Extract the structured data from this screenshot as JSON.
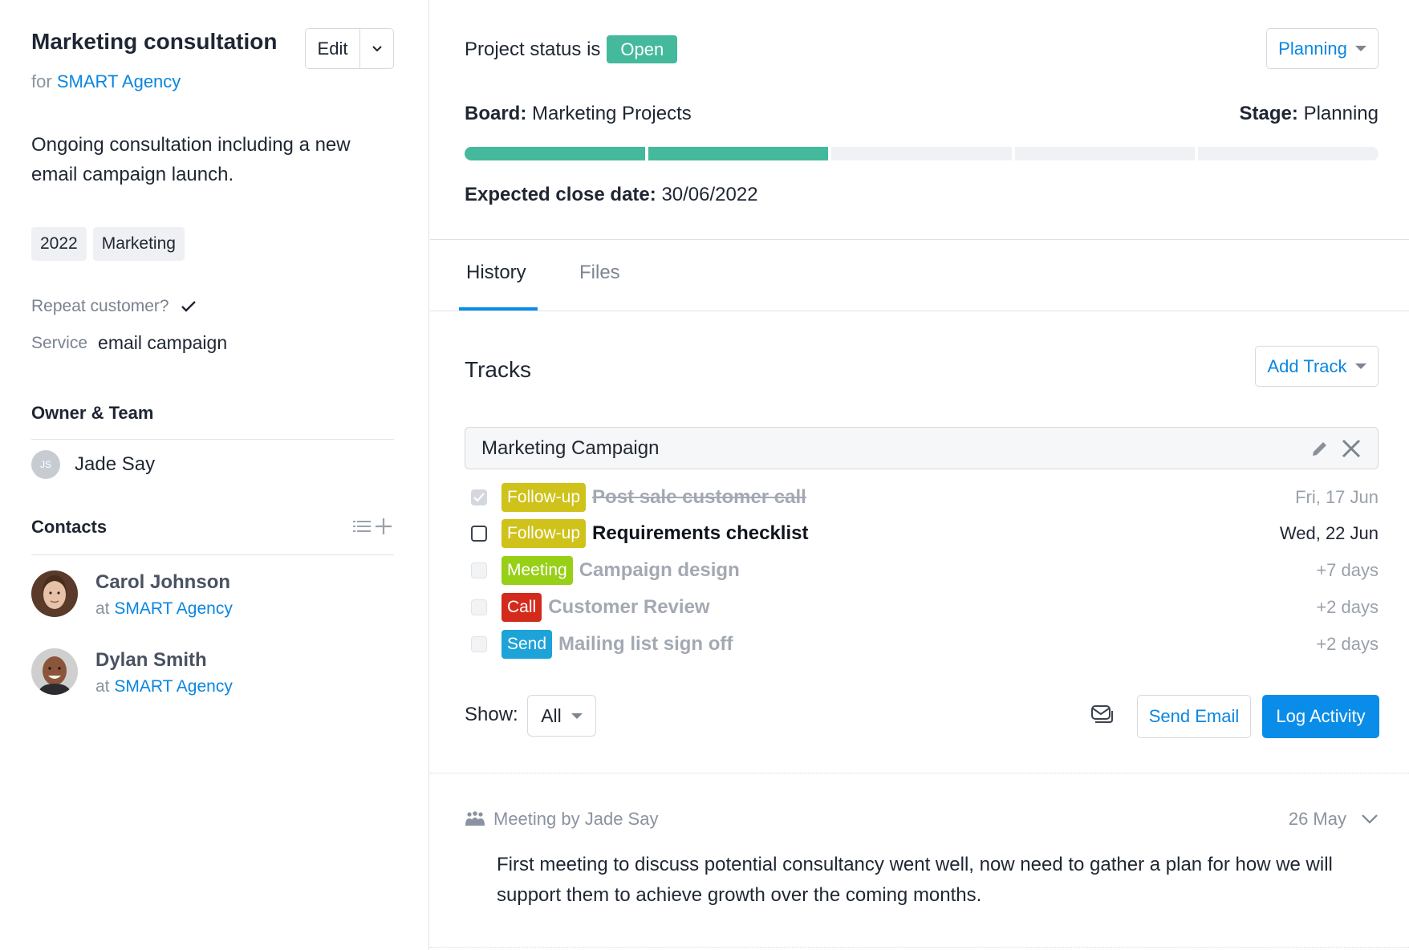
{
  "project": {
    "title": "Marketing consultation",
    "for_prefix": "for",
    "company": "SMART Agency",
    "edit_label": "Edit",
    "description": "Ongoing consultation including a new email campaign launch.",
    "tags": [
      "2022",
      "Marketing"
    ],
    "fields": {
      "repeat_customer_label": "Repeat customer?",
      "repeat_customer_value": true,
      "service_label": "Service",
      "service_value": "email campaign"
    },
    "owner_section_title": "Owner & Team",
    "owner": {
      "initials": "JS",
      "name": "Jade Say"
    },
    "contacts_section_title": "Contacts",
    "contacts": [
      {
        "name": "Carol Johnson",
        "at_prefix": "at",
        "company": "SMART Agency"
      },
      {
        "name": "Dylan Smith",
        "at_prefix": "at",
        "company": "SMART Agency"
      }
    ]
  },
  "status": {
    "label": "Project status is",
    "badge": "Open",
    "badge_color": "#45b99b",
    "stage_dropdown": "Planning",
    "board_label": "Board:",
    "board_value": "Marketing Projects",
    "stage_label": "Stage:",
    "stage_value": "Planning",
    "progress": {
      "completed_stages": 2,
      "total_stages": 5
    },
    "close_label": "Expected close date:",
    "close_value": "30/06/2022"
  },
  "tabs": [
    {
      "label": "History",
      "active": true
    },
    {
      "label": "Files",
      "active": false
    }
  ],
  "tracks": {
    "title": "Tracks",
    "add_button": "Add Track",
    "track_name": "Marketing Campaign",
    "tasks": [
      {
        "type": "Follow-up",
        "type_color": "#cfc21a",
        "title": "Post sale customer call",
        "date": "Fri, 17 Jun",
        "state": "done"
      },
      {
        "type": "Follow-up",
        "type_color": "#cfc21a",
        "title": "Requirements checklist",
        "date": "Wed, 22 Jun",
        "state": "current"
      },
      {
        "type": "Meeting",
        "type_color": "#98cf17",
        "title": "Campaign design",
        "date": "+7 days",
        "state": "future"
      },
      {
        "type": "Call",
        "type_color": "#d42a1c",
        "title": "Customer Review",
        "date": "+2 days",
        "state": "future"
      },
      {
        "type": "Send",
        "type_color": "#1ea3d8",
        "title": "Mailing list sign off",
        "date": "+2 days",
        "state": "future"
      }
    ],
    "show_label": "Show:",
    "show_value": "All",
    "send_email": "Send Email",
    "log_activity": "Log Activity"
  },
  "activity": {
    "heading": "Meeting by Jade Say",
    "date": "26 May",
    "body": "First meeting to discuss potential consultancy went well, now need to gather a plan for how we will support them to achieve growth over the coming months."
  },
  "colors": {
    "accent": "#0a8de8",
    "link": "#0a86e0",
    "success": "#45b99b"
  }
}
